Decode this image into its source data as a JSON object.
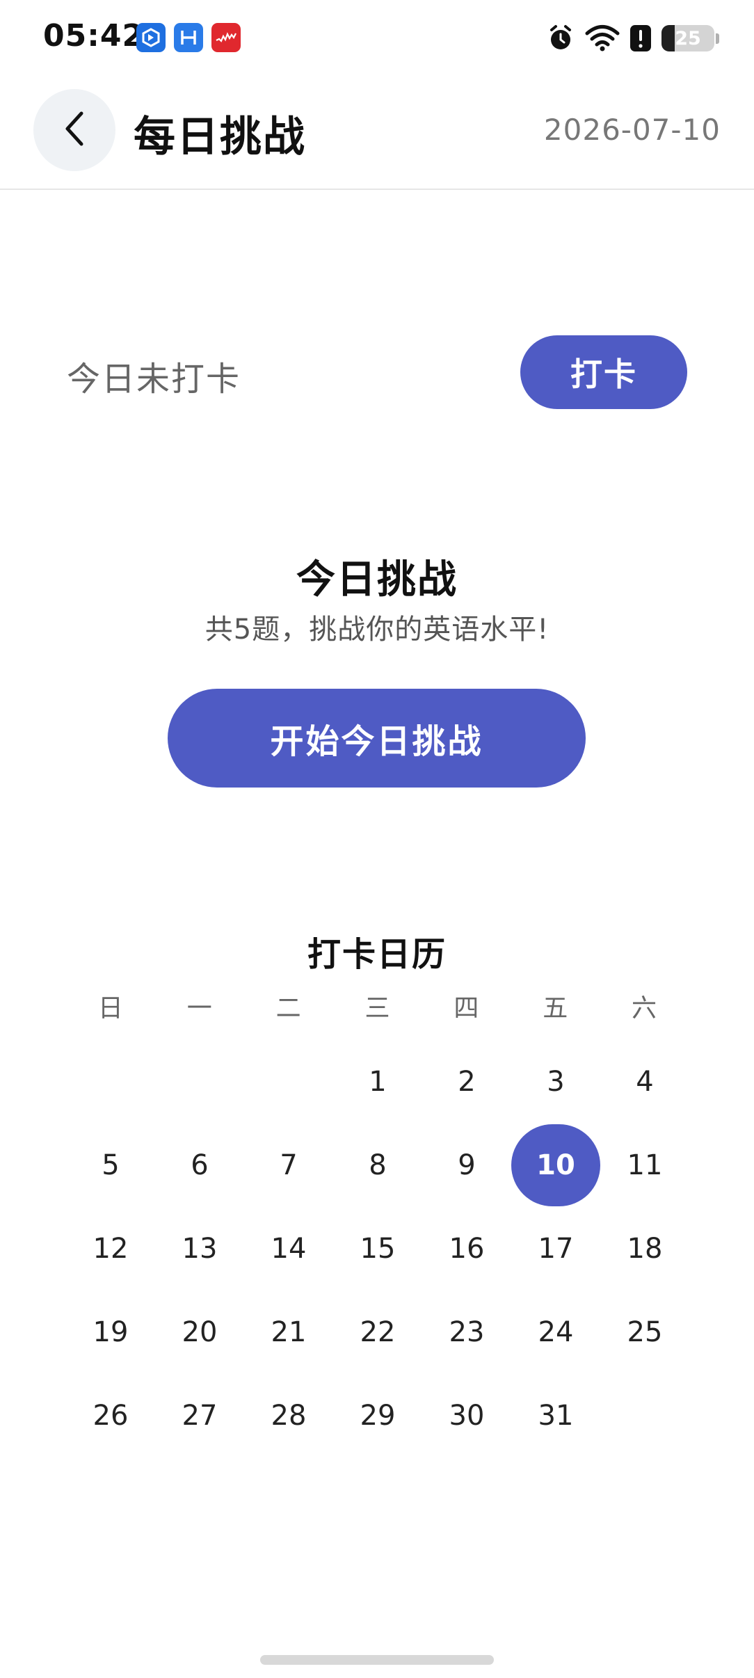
{
  "status_bar": {
    "time": "05:42",
    "battery_level": "25",
    "icons": [
      "app-icon-1",
      "app-icon-2",
      "app-icon-3",
      "alarm-icon",
      "wifi-icon",
      "alert-icon",
      "battery-icon"
    ]
  },
  "header": {
    "title": "每日挑战",
    "date": "2026-07-10",
    "back_icon": "chevron-left-icon"
  },
  "checkin": {
    "status_text": "今日未打卡",
    "button_label": "打卡"
  },
  "challenge": {
    "title": "今日挑战",
    "subtitle": "共5题，挑战你的英语水平!",
    "start_button_label": "开始今日挑战"
  },
  "calendar": {
    "title": "打卡日历",
    "weekdays": [
      "日",
      "一",
      "二",
      "三",
      "四",
      "五",
      "六"
    ],
    "first_weekday_index": 3,
    "days": [
      "1",
      "2",
      "3",
      "4",
      "5",
      "6",
      "7",
      "8",
      "9",
      "10",
      "11",
      "12",
      "13",
      "14",
      "15",
      "16",
      "17",
      "18",
      "19",
      "20",
      "21",
      "22",
      "23",
      "24",
      "25",
      "26",
      "27",
      "28",
      "29",
      "30",
      "31"
    ],
    "selected_day": "10"
  },
  "colors": {
    "accent": "#4f5bc4",
    "text_primary": "#111111",
    "text_secondary": "#666666",
    "back_button_bg": "#eff2f5"
  }
}
